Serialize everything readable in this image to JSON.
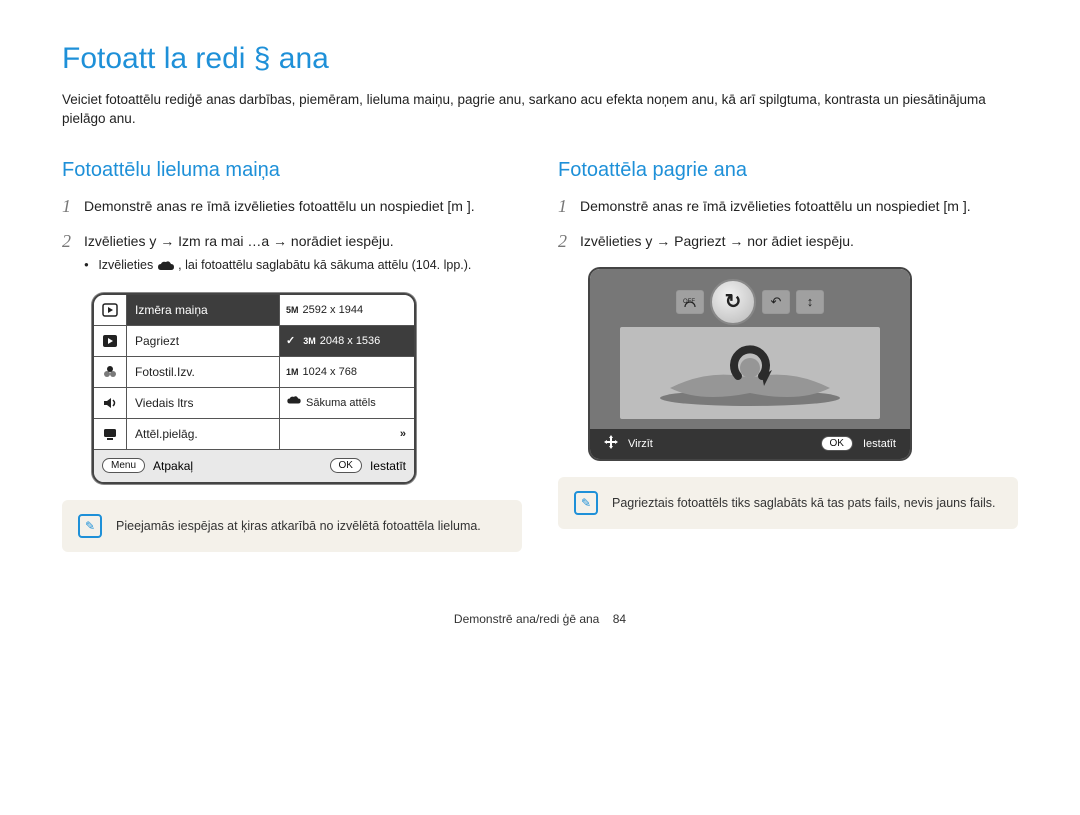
{
  "title": "Fotoatt  la redi §  ana",
  "intro": "Veiciet fotoattēlu rediģē anas darbības, piemēram, lieluma maiņu, pagrie anu, sarkano acu efekta noņem anu, kā arī spilgtuma, kontrasta un piesātinājuma pielāgo anu.",
  "left": {
    "heading": "Fotoattēlu lieluma maiņa",
    "step1": "Demonstrē anas re  īmā izvēlieties fotoattēlu un nospiediet [m   ].",
    "step2": "Izvēlieties y   → Izm  ra mai …a → norādiet iespēju.",
    "bullet": "Izvēlieties       , lai fotoattēlu saglabātu kā sākuma attēlu (104. lpp.).",
    "menu": {
      "items": [
        "Izmēra maiņa",
        "Pagriezt",
        "Fotostil.Izv.",
        "Viedais  ltrs",
        "Attēl.pielāg."
      ],
      "options": [
        "2592 x 1944",
        "2048 x 1536",
        "1024 x 768",
        "Sākuma attēls"
      ],
      "sizebadges": [
        "5M",
        "3M",
        "1M"
      ],
      "footer_back_btn": "Menu",
      "footer_back": "Atpakaļ",
      "footer_set_btn": "OK",
      "footer_set": "Iestatīt"
    },
    "note": "Pieejamās iespējas at ķiras atkarībā no izvēlētā fotoattēla lieluma."
  },
  "right": {
    "heading": "Fotoattēla pagrie ana",
    "step1": "Demonstrē anas re  īmā izvēlieties fotoattēlu un nospiediet [m   ].",
    "step2": "Izvēlieties y   → Pagriezt → nor ādiet iespēju.",
    "ui": {
      "move_label": "Virzīt",
      "set_btn": "OK",
      "set_label": "Iestatīt"
    },
    "note": "Pagrieztais fotoattēls tiks saglabāts kā tas pats fails, nevis jauns fails."
  },
  "footer": {
    "section": "Demonstrē ana/redi ģē ana",
    "page": "84"
  }
}
